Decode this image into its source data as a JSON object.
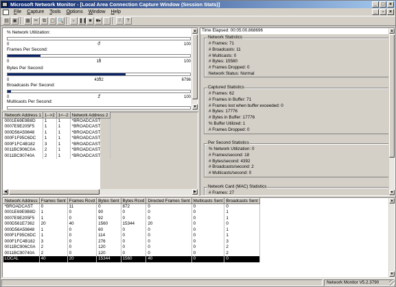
{
  "window": {
    "title": "Microsoft Network Monitor - [Local Area Connection Capture Window (Session Stats)]",
    "minimize": "_",
    "maximize": "□",
    "close": "×",
    "mdi_minimize": "_",
    "mdi_restore": "▫",
    "mdi_close": "×"
  },
  "menu": [
    {
      "label": "File",
      "key": "F",
      "rest": "ile"
    },
    {
      "label": "Capture",
      "key": "C",
      "rest": "apture"
    },
    {
      "label": "Tools",
      "key": "T",
      "rest": "ools"
    },
    {
      "label": "Options",
      "key": "O",
      "rest": "ptions"
    },
    {
      "label": "Window",
      "key": "W",
      "rest": "indow"
    },
    {
      "label": "Help",
      "key": "H",
      "rest": "elp"
    }
  ],
  "toolbar": {
    "icons": [
      "new-capture-icon",
      "save-icon",
      "print-icon",
      "cut-icon",
      "copy-icon",
      "paste-icon",
      "find-icon",
      "start-capture-icon",
      "pause-icon",
      "stop-icon",
      "stop-and-view-icon",
      "view-icon",
      "display-captured-data-icon",
      "help-icon"
    ],
    "glyphs": [
      "▤",
      "▣",
      "▦",
      "✂",
      "⧉",
      "▢",
      "🔍",
      "▸",
      "❚❚",
      "■",
      "■▸",
      "▯",
      "Ѫ",
      "?"
    ]
  },
  "graphs": [
    {
      "label": "% Network Utilization:",
      "min": "0",
      "mid": "0",
      "max": "100",
      "fraction": 0.0
    },
    {
      "label": "Frames Per Second:",
      "min": "0",
      "mid": "18",
      "max": "100",
      "fraction": 0.18
    },
    {
      "label": "Bytes Per Second:",
      "min": "0",
      "mid": "4392",
      "max": "6796",
      "fraction": 0.646
    },
    {
      "label": "Broadcasts Per Second:",
      "min": "0",
      "mid": "2",
      "max": "100",
      "fraction": 0.02
    },
    {
      "label": "Multicasts Per Second:",
      "min": "",
      "mid": "",
      "max": "",
      "fraction": 0.0
    }
  ],
  "station_table": {
    "headers": [
      "Network Address 1",
      "1-->2",
      "1<--2",
      "Network Address 2"
    ],
    "rows": [
      [
        "0001E69E9B8D",
        "1",
        "1",
        "*BROADCAST"
      ],
      [
        "0007E9E205F5",
        "1",
        "1",
        "*BROADCAST"
      ],
      [
        "000D56A59848",
        "1",
        "1",
        "*BROADCAST"
      ],
      [
        "000F1F95C6DC",
        "1",
        "1",
        "*BROADCAST"
      ],
      [
        "000F1FC4B182",
        "3",
        "1",
        "*BROADCAST"
      ],
      [
        "0011BC906C0A",
        "2",
        "1",
        "*BROADCAST"
      ],
      [
        "0011BC90740A",
        "2",
        "1",
        "*BROADCAST"
      ]
    ]
  },
  "session_stats": {
    "time_elapsed": "Time Elapsed: 00:05:00.868696",
    "network_statistics": {
      "title": "Network Statistics",
      "lines": [
        "# Frames: 71",
        "# Broadcasts: 11",
        "# Multicasts: 0",
        "# Bytes: 15580",
        "# Frames Dropped: 0",
        "Network Status: Normal"
      ]
    },
    "captured_statistics": {
      "title": "Captured Statistics",
      "lines": [
        "# Frames: 62",
        "# Frames in Buffer: 71",
        "# Frames lost when buffer exceeded: 0",
        "# Bytes: 17776",
        "# Bytes in Buffer: 17776",
        "% Buffer Utilized: 1",
        "# Frames Dropped: 0"
      ]
    },
    "per_second_statistics": {
      "title": "Per Second Statistics",
      "lines": [
        "% Network Utilization: 0",
        "# Frames/second: 18",
        "# Bytes/second: 4392",
        "# Broadcasts/second: 2",
        "# Multicasts/second: 0"
      ]
    },
    "network_card_statistics": {
      "title": "Network Card (MAC) Statistics",
      "lines": [
        "# Frames: 27"
      ]
    }
  },
  "address_table": {
    "headers": [
      "Network Address",
      "Frames Sent",
      "Frames Rcvd",
      "Bytes Sent",
      "Bytes Rcvd",
      "Directed Frames Sent",
      "Multicasts Sent",
      "Broadcasts Sent"
    ],
    "rows": [
      [
        "*BROADCAST",
        "0",
        "11",
        "0",
        "872",
        "0",
        "0",
        "0"
      ],
      [
        "0001E69E9B8D",
        "1",
        "0",
        "90",
        "0",
        "0",
        "0",
        "1"
      ],
      [
        "0007E9E205F5",
        "1",
        "0",
        "92",
        "0",
        "0",
        "0",
        "1"
      ],
      [
        "000D561E7362",
        "20",
        "40",
        "1560",
        "15344",
        "20",
        "0",
        "0"
      ],
      [
        "000D56A59848",
        "1",
        "0",
        "60",
        "0",
        "0",
        "0",
        "1"
      ],
      [
        "000F1F95C6DC",
        "1",
        "0",
        "114",
        "0",
        "0",
        "0",
        "1"
      ],
      [
        "000F1FC4B182",
        "3",
        "0",
        "276",
        "0",
        "0",
        "0",
        "3"
      ],
      [
        "0011BC906C0A",
        "2",
        "0",
        "120",
        "0",
        "0",
        "0",
        "2"
      ],
      [
        "0011BC90740A",
        "2",
        "0",
        "120",
        "0",
        "0",
        "0",
        "2"
      ],
      [
        "LOCAL",
        "40",
        "20",
        "15344",
        "1560",
        "40",
        "0",
        "0"
      ]
    ],
    "selected_row": 9
  },
  "status_bar": {
    "version": "Network Monitor V5.2.3790"
  },
  "colors": {
    "title_start": "#0a246a",
    "title_end": "#a6caf0",
    "graph_fill": "#0a246a",
    "face": "#d4d0c8",
    "selection": "#000000"
  }
}
